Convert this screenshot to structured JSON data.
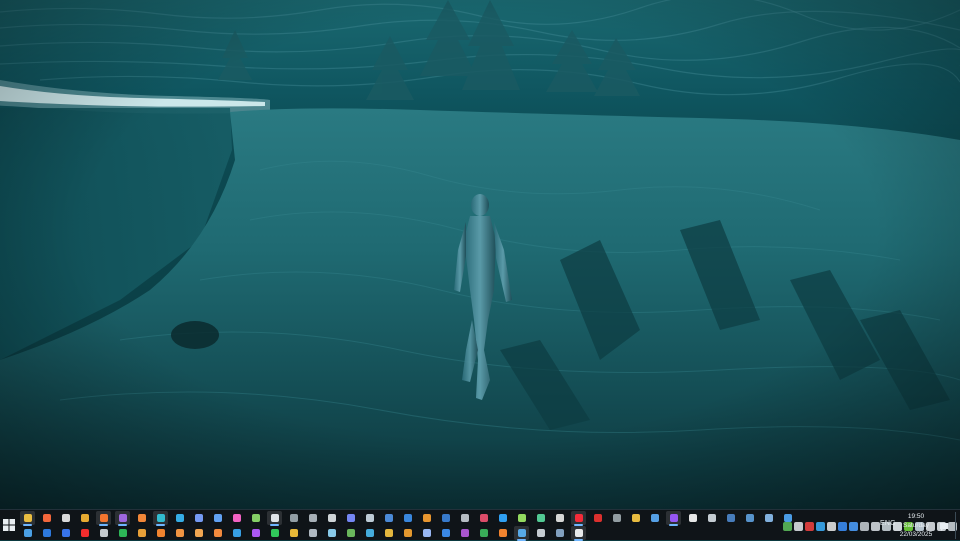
{
  "colors": {
    "water_top": "#0e5660",
    "water_mid": "#1b6b73",
    "water_deep": "#0a2e33",
    "taskbar": "#0f1418",
    "accent": "#6fb6ff"
  },
  "taskbar": {
    "row1_apps": [
      {
        "icon": "file-explorer-icon",
        "color": "#f4c542"
      },
      {
        "icon": "paint-icon",
        "color": "#ff6a3d"
      },
      {
        "icon": "obs-icon",
        "color": "#e5e5e5"
      },
      {
        "icon": "chrome-icon",
        "color": "#f2b233"
      },
      {
        "icon": "firefox-icon",
        "color": "#ff7a2f"
      },
      {
        "icon": "visual-studio-icon",
        "color": "#a46ae8"
      },
      {
        "icon": "firefox-dev-icon",
        "color": "#ff8c3a"
      },
      {
        "icon": "edge-icon",
        "color": "#33c4d8"
      },
      {
        "icon": "cube-icon",
        "color": "#38b4f0"
      },
      {
        "icon": "chat-icon",
        "color": "#7aa0ff"
      },
      {
        "icon": "notepad-icon",
        "color": "#66a9ff"
      },
      {
        "icon": "color-picker-icon",
        "color": "#ff66cc"
      },
      {
        "icon": "document-icon",
        "color": "#8bd86a"
      },
      {
        "icon": "check-icon",
        "color": "#e9eef2"
      },
      {
        "icon": "terminal-icon",
        "color": "#9aa5ad"
      },
      {
        "icon": "shield-icon",
        "color": "#b0b8c0"
      },
      {
        "icon": "cloud-icon",
        "color": "#d9dee2"
      },
      {
        "icon": "discord-icon",
        "color": "#7a8cff"
      },
      {
        "icon": "steam-icon",
        "color": "#c7d5e0"
      },
      {
        "icon": "editor-icon",
        "color": "#4f8fe0"
      },
      {
        "icon": "image-icon",
        "color": "#3c8ce7"
      },
      {
        "icon": "rss-icon",
        "color": "#f39c30"
      },
      {
        "icon": "tablet-icon",
        "color": "#3a7fd5"
      },
      {
        "icon": "gear-icon",
        "color": "#c0c6cc"
      },
      {
        "icon": "calendar-icon",
        "color": "#e84f6e"
      },
      {
        "icon": "photoshop-icon",
        "color": "#31a8ff"
      },
      {
        "icon": "substance-icon",
        "color": "#9be564"
      },
      {
        "icon": "designer-icon",
        "color": "#56d39a"
      },
      {
        "icon": "headphones-icon",
        "color": "#e0e0e0"
      },
      {
        "icon": "opera-icon",
        "color": "#ff2b3a"
      },
      {
        "icon": "pdf-icon",
        "color": "#e8322f"
      },
      {
        "icon": "cat-icon",
        "color": "#9aa4aa"
      },
      {
        "icon": "folder-icon",
        "color": "#f4c542"
      },
      {
        "icon": "brush-icon",
        "color": "#5aa8f0"
      },
      {
        "icon": "game-icon",
        "color": "#9b59ff"
      },
      {
        "icon": "page-icon",
        "color": "#f2f2f2"
      },
      {
        "icon": "arrow-icon",
        "color": "#cfd6dc"
      },
      {
        "icon": "monitor-icon",
        "color": "#4b82c4"
      },
      {
        "icon": "tool-icon",
        "color": "#5c9ad6"
      },
      {
        "icon": "box-icon",
        "color": "#88b8e8"
      },
      {
        "icon": "window-icon",
        "color": "#4ea3f0"
      }
    ],
    "row2_apps": [
      {
        "icon": "grid-icon",
        "color": "#4fa8f0"
      },
      {
        "icon": "doc-blue-icon",
        "color": "#2f7ee8"
      },
      {
        "icon": "facebook-icon",
        "color": "#3b79f5"
      },
      {
        "icon": "youtube-icon",
        "color": "#ff2e2e"
      },
      {
        "icon": "console-icon",
        "color": "#cfd4d8"
      },
      {
        "icon": "xbox-icon",
        "color": "#2fbf5b"
      },
      {
        "icon": "music-icon",
        "color": "#f4a83a"
      },
      {
        "icon": "fire-icon",
        "color": "#ff8a30"
      },
      {
        "icon": "fire-alt-icon",
        "color": "#ff9b45"
      },
      {
        "icon": "fire-3-icon",
        "color": "#ffae55"
      },
      {
        "icon": "fire-4-icon",
        "color": "#ff9040"
      },
      {
        "icon": "store-icon",
        "color": "#3aa7ef"
      },
      {
        "icon": "purple-app-icon",
        "color": "#b45cff"
      },
      {
        "icon": "whatsapp-icon",
        "color": "#33d15e"
      },
      {
        "icon": "paint-alt-icon",
        "color": "#f3c13a"
      },
      {
        "icon": "monitor-alt-icon",
        "color": "#b8c2ca"
      },
      {
        "icon": "network-icon",
        "color": "#8fd4f4"
      },
      {
        "icon": "tree-icon",
        "color": "#70c060"
      },
      {
        "icon": "circle-icon",
        "color": "#49b4e8"
      },
      {
        "icon": "folder-alt-icon",
        "color": "#f0c040"
      },
      {
        "icon": "edit-icon",
        "color": "#f0a030"
      },
      {
        "icon": "user-icon",
        "color": "#a0c0ff"
      },
      {
        "icon": "mail-icon",
        "color": "#3d8ef0"
      },
      {
        "icon": "onenote-icon",
        "color": "#b25ad8"
      },
      {
        "icon": "sheet-icon",
        "color": "#3cb35c"
      },
      {
        "icon": "fire-5-icon",
        "color": "#ff8a30"
      },
      {
        "icon": "book-icon",
        "color": "#5ab0f0"
      },
      {
        "icon": "file-icon",
        "color": "#d0d6dc"
      },
      {
        "icon": "calc-icon",
        "color": "#89a8c8"
      },
      {
        "icon": "unreal-icon",
        "color": "#f2f4f6"
      }
    ],
    "tray_icons": [
      {
        "icon": "antivirus-tray-icon",
        "color": "#5ab85a"
      },
      {
        "icon": "car-tray-icon",
        "color": "#d8dde2"
      },
      {
        "icon": "record-tray-icon",
        "color": "#e84040"
      },
      {
        "icon": "store-tray-icon",
        "color": "#3aa7ef"
      },
      {
        "icon": "sync-tray-icon",
        "color": "#e0e0e0"
      },
      {
        "icon": "shield-tray-icon",
        "color": "#3a8af0"
      },
      {
        "icon": "bluetooth-tray-icon",
        "color": "#4a9af5"
      },
      {
        "icon": "settings-tray-icon",
        "color": "#c0c6cc"
      },
      {
        "icon": "send-tray-icon",
        "color": "#d0d6dc"
      },
      {
        "icon": "chevron-tray-icon",
        "color": "#c8d0d6"
      },
      {
        "icon": "volume-tray-icon",
        "color": "#e6ebef"
      },
      {
        "icon": "nvidia-tray-icon",
        "color": "#6fcf3a"
      },
      {
        "icon": "steam-tray-icon",
        "color": "#c7d5e0"
      },
      {
        "icon": "onedrive-tray-icon",
        "color": "#d9dee2"
      },
      {
        "icon": "network-tray-icon",
        "color": "#e0e5e9"
      },
      {
        "icon": "power-tray-icon",
        "color": "#c8ced4"
      }
    ],
    "language": "ENG",
    "time": "19:50",
    "day": "Saturday",
    "date": "22/03/2025"
  }
}
